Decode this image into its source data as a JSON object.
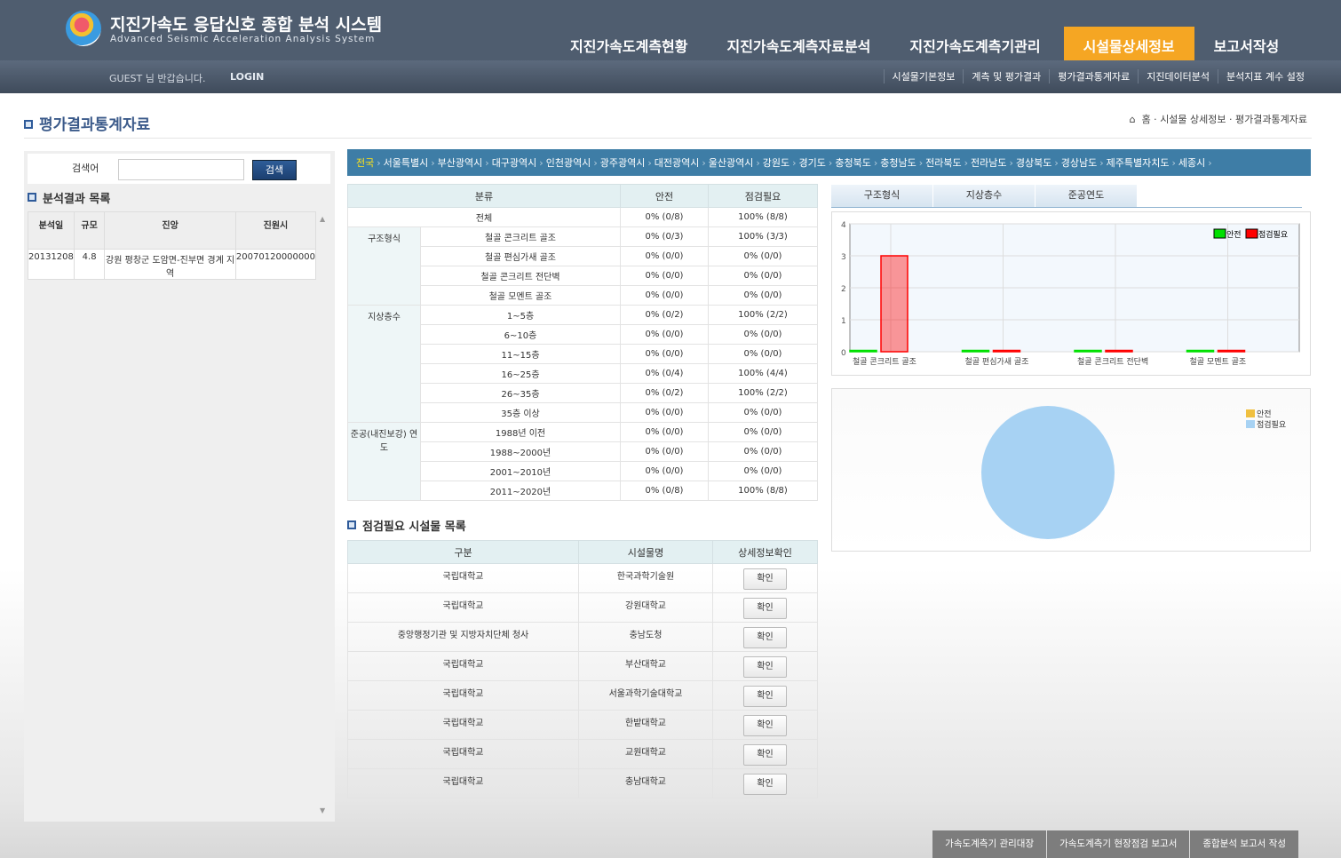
{
  "header": {
    "title": "지진가속도 응답신호 종합 분석 시스템",
    "subtitle": "Advanced Seismic Acceleration Analysis System",
    "main_nav": [
      "지진가속도계측현황",
      "지진가속도계측자료분석",
      "지진가속도계측기관리",
      "시설물상세정보",
      "보고서작성"
    ],
    "greeting": "GUEST 님 반갑습니다.",
    "login": "LOGIN",
    "sub_nav": [
      "시설물기본정보",
      "계측 및 평가결과",
      "평가결과통계자료",
      "지진데이터분석",
      "분석지표 계수 설정"
    ]
  },
  "page": {
    "title": "평가결과통계자료",
    "breadcrumb": [
      "홈",
      "시설물 상세정보",
      "평가결과통계자료"
    ]
  },
  "left": {
    "search_label": "검색어",
    "search_value": "",
    "search_button": "검색",
    "list_title": "분석결과 목록",
    "columns": [
      "분석일",
      "규모",
      "진앙",
      "진원시"
    ],
    "rows": [
      [
        "20131208",
        "4.8",
        "강원 평창군 도암면-진부면 경계 지역",
        "20070120000000"
      ]
    ]
  },
  "regions": {
    "items": [
      "전국",
      "서울특별시",
      "부산광역시",
      "대구광역시",
      "인천광역시",
      "광주광역시",
      "대전광역시",
      "울산광역시",
      "강원도",
      "경기도",
      "충청북도",
      "충청남도",
      "전라북도",
      "전라남도",
      "경상북도",
      "경상남도",
      "제주특별자치도",
      "세종시"
    ],
    "selected": "전국"
  },
  "stats": {
    "columns": [
      "분류",
      "안전",
      "점검필요"
    ],
    "total": {
      "label": "전체",
      "safe": "0% (0/8)",
      "need": "100% (8/8)"
    },
    "groups": [
      {
        "name": "구조형식",
        "rows": [
          [
            "철골 콘크리트 골조",
            "0% (0/3)",
            "100% (3/3)"
          ],
          [
            "철골 편심가새 골조",
            "0% (0/0)",
            "0% (0/0)"
          ],
          [
            "철골 콘크리트 전단벽",
            "0% (0/0)",
            "0% (0/0)"
          ],
          [
            "철골 모멘트 골조",
            "0% (0/0)",
            "0% (0/0)"
          ]
        ]
      },
      {
        "name": "지상층수",
        "rows": [
          [
            "1~5층",
            "0% (0/2)",
            "100% (2/2)"
          ],
          [
            "6~10층",
            "0% (0/0)",
            "0% (0/0)"
          ],
          [
            "11~15층",
            "0% (0/0)",
            "0% (0/0)"
          ],
          [
            "16~25층",
            "0% (0/4)",
            "100% (4/4)"
          ],
          [
            "26~35층",
            "0% (0/2)",
            "100% (2/2)"
          ],
          [
            "35층 이상",
            "0% (0/0)",
            "0% (0/0)"
          ]
        ]
      },
      {
        "name": "준공(내진보강) 연도",
        "rows": [
          [
            "1988년 이전",
            "0% (0/0)",
            "0% (0/0)"
          ],
          [
            "1988~2000년",
            "0% (0/0)",
            "0% (0/0)"
          ],
          [
            "2001~2010년",
            "0% (0/0)",
            "0% (0/0)"
          ],
          [
            "2011~2020년",
            "0% (0/8)",
            "100% (8/8)"
          ]
        ]
      }
    ]
  },
  "chart_tabs": [
    "구조형식",
    "지상층수",
    "준공연도"
  ],
  "chart_data": [
    {
      "type": "bar",
      "categories": [
        "철골 콘크리트 골조",
        "철골 편심가새 골조",
        "철골 콘크리트 전단벽",
        "철골 모멘트 골조"
      ],
      "series": [
        {
          "name": "안전",
          "color": "#00e000",
          "values": [
            0,
            0,
            0,
            0
          ]
        },
        {
          "name": "점검필요",
          "color": "#ff0000",
          "values": [
            3,
            0,
            0,
            0
          ]
        }
      ],
      "ylim": [
        0,
        4
      ],
      "yticks": [
        "0",
        "1",
        "2",
        "3",
        "4"
      ],
      "legend": "top-right"
    },
    {
      "type": "pie",
      "series": [
        {
          "name": "안전",
          "color": "#f0c040",
          "value": 0
        },
        {
          "name": "점검필요",
          "color": "#a7d2f3",
          "value": 8
        }
      ],
      "legend": "top-right"
    }
  ],
  "need_list": {
    "title": "점검필요 시설물 목록",
    "columns": [
      "구분",
      "시설물명",
      "상세정보확인"
    ],
    "button": "확인",
    "rows": [
      [
        "국립대학교",
        "한국과학기술원"
      ],
      [
        "국립대학교",
        "강원대학교"
      ],
      [
        "중앙행정기관 및 지방자치단체 청사",
        "충남도청"
      ],
      [
        "국립대학교",
        "부산대학교"
      ],
      [
        "국립대학교",
        "서울과학기술대학교"
      ],
      [
        "국립대학교",
        "한밭대학교"
      ],
      [
        "국립대학교",
        "교원대학교"
      ],
      [
        "국립대학교",
        "충남대학교"
      ]
    ]
  },
  "footer": [
    "가속도계측기 관리대장",
    "가속도계측기 현장점검 보고서",
    "종합분석 보고서 작성"
  ]
}
